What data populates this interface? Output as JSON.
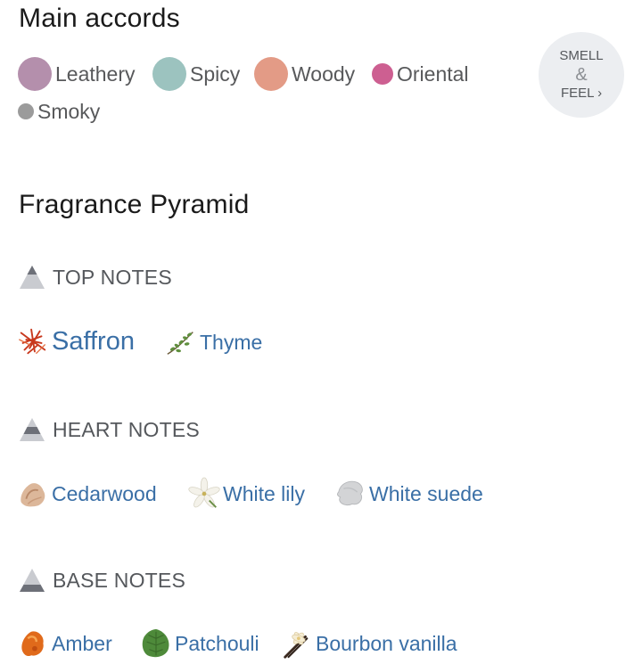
{
  "accords": {
    "title": "Main accords",
    "items": [
      {
        "label": "Leathery",
        "color": "#b48fac"
      },
      {
        "label": "Spicy",
        "color": "#9cc3bf"
      },
      {
        "label": "Woody",
        "color": "#e39b86"
      },
      {
        "label": "Oriental",
        "color": "#cd5f91"
      },
      {
        "label": "Smoky",
        "color": "#9b9b9b"
      }
    ],
    "smell_feel": {
      "line1": "SMELL",
      "amp": "&",
      "line2": "FEEL ›"
    }
  },
  "pyramid": {
    "title": "Fragrance Pyramid",
    "top": {
      "label": "TOP NOTES",
      "notes": [
        {
          "name": "Saffron",
          "icon": "saffron-icon"
        },
        {
          "name": "Thyme",
          "icon": "thyme-icon"
        }
      ]
    },
    "heart": {
      "label": "HEART NOTES",
      "notes": [
        {
          "name": "Cedarwood",
          "icon": "cedarwood-icon"
        },
        {
          "name": "White lily",
          "icon": "lily-icon"
        },
        {
          "name": "White suede",
          "icon": "suede-icon"
        }
      ]
    },
    "base": {
      "label": "BASE NOTES",
      "notes": [
        {
          "name": "Amber",
          "icon": "amber-icon"
        },
        {
          "name": "Patchouli",
          "icon": "patchouli-icon"
        },
        {
          "name": "Bourbon vanilla",
          "icon": "vanilla-icon"
        }
      ]
    }
  },
  "colors": {
    "link": "#3a6fa6",
    "muted_text": "#58595b",
    "button_bg": "#eceef1"
  }
}
